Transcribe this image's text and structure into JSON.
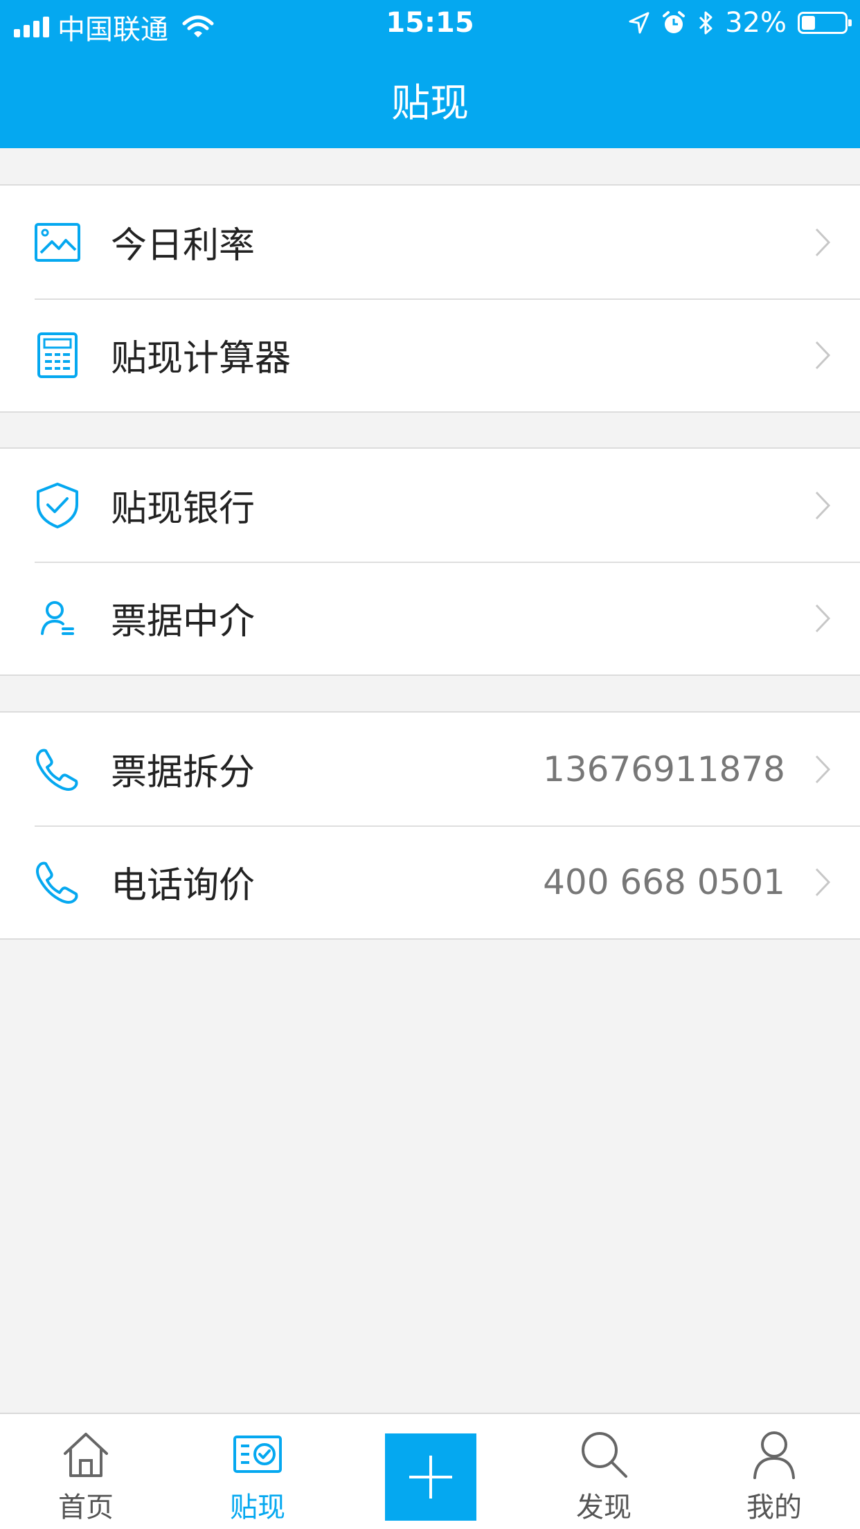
{
  "status_bar": {
    "carrier": "中国联通",
    "time": "15:15",
    "battery_percent": "32%",
    "battery_level": 0.32
  },
  "header": {
    "title": "贴现"
  },
  "groups": [
    {
      "items": [
        {
          "label": "今日利率",
          "icon": "image-icon",
          "value": ""
        },
        {
          "label": "贴现计算器",
          "icon": "calculator-icon",
          "value": ""
        }
      ]
    },
    {
      "items": [
        {
          "label": "贴现银行",
          "icon": "shield-check-icon",
          "value": ""
        },
        {
          "label": "票据中介",
          "icon": "user-icon",
          "value": ""
        }
      ]
    },
    {
      "items": [
        {
          "label": "票据拆分",
          "icon": "phone-icon",
          "value": "13676911878"
        },
        {
          "label": "电话询价",
          "icon": "phone-icon",
          "value": "400 668 0501"
        }
      ]
    }
  ],
  "tab_bar": {
    "tabs": [
      {
        "label": "首页",
        "icon": "home-icon",
        "active": false
      },
      {
        "label": "贴现",
        "icon": "discount-icon",
        "active": true
      },
      {
        "label": "发现",
        "icon": "search-icon",
        "active": false
      },
      {
        "label": "我的",
        "icon": "user-icon",
        "active": false
      }
    ],
    "add_icon": "plus-icon"
  },
  "colors": {
    "accent": "#05a8f0",
    "background": "#f3f3f3",
    "text": "#222222",
    "secondary_text": "#777777"
  }
}
